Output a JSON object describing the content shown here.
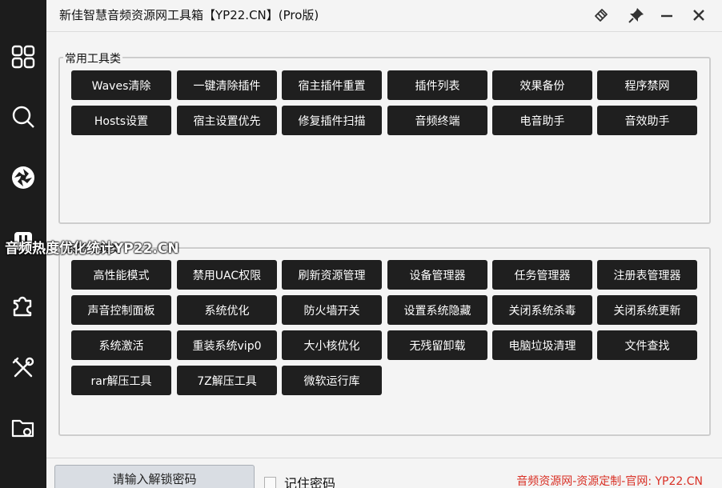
{
  "window": {
    "title": "新佳智慧音频资源网工具箱【YP22.CN】(Pro版)"
  },
  "colors": {
    "sidebar_bg": "#1c1c1c",
    "button_bg": "#1f1f1f",
    "button_text": "#ffffff",
    "footer_link": "#d93025"
  },
  "sidebar": {
    "icons": [
      "grid-icon",
      "search-icon",
      "aperture-icon",
      "plug-icon",
      "puzzle-icon",
      "tools-icon",
      "folder-settings-icon"
    ]
  },
  "watermark": {
    "text": "音频热度优化统计YP22.CN"
  },
  "groups": [
    {
      "legend": "常用工具类",
      "buttons": [
        "Waves清除",
        "一键清除插件",
        "宿主插件重置",
        "插件列表",
        "效果备份",
        "程序禁网",
        "Hosts设置",
        "宿主设置优先",
        "修复插件扫描",
        "音频终端",
        "电音助手",
        "音效助手"
      ]
    },
    {
      "legend": "系统工具类",
      "buttons": [
        "高性能模式",
        "禁用UAC权限",
        "刷新资源管理",
        "设备管理器",
        "任务管理器",
        "注册表管理器",
        "声音控制面板",
        "系统优化",
        "防火墙开关",
        "设置系统隐藏",
        "关闭系统杀毒",
        "关闭系统更新",
        "系统激活",
        "重装系统vip0",
        "大小核优化",
        "无残留卸载",
        "电脑垃圾清理",
        "文件查找",
        "rar解压工具",
        "7Z解压工具",
        "微软运行库"
      ]
    }
  ],
  "bottom": {
    "unlock_button": "请输入解锁密码",
    "remember_label": "记住密码",
    "footer_link": "音频资源网-资源定制-官网: YP22.CN"
  }
}
